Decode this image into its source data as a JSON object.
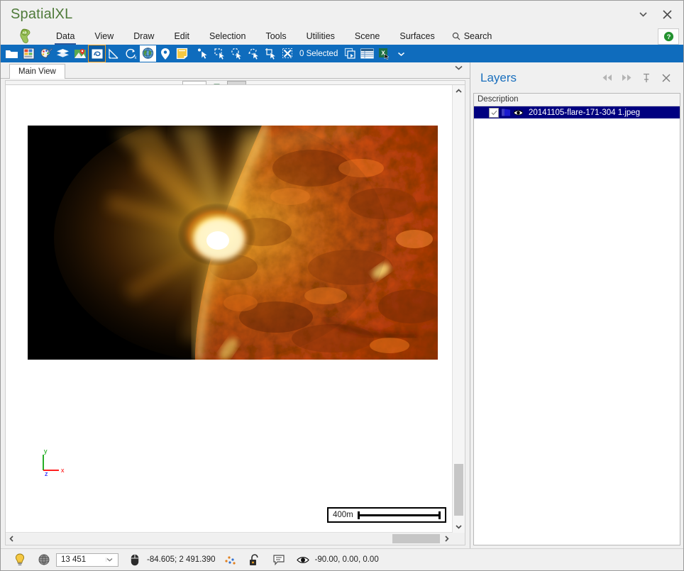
{
  "window": {
    "title": "SpatialXL",
    "title_color": "#4e7a39",
    "dropdown_icon": "chevron-down-icon",
    "close_icon": "close-icon"
  },
  "menubar": {
    "app_icon": "ab-globe-icon",
    "items": [
      {
        "label": "Data",
        "active": true
      },
      {
        "label": "View",
        "active": false
      },
      {
        "label": "Draw",
        "active": false
      },
      {
        "label": "Edit",
        "active": false
      },
      {
        "label": "Selection",
        "active": false
      },
      {
        "label": "Tools",
        "active": false
      },
      {
        "label": "Utilities",
        "active": false
      },
      {
        "label": "Scene",
        "active": false
      },
      {
        "label": "Surfaces",
        "active": false
      }
    ],
    "search_label": "Search",
    "search_icon": "search-icon",
    "help_icon": "help-icon",
    "help_color": "#23912f"
  },
  "ribbon": {
    "background": "#0f6cbd",
    "selection_status": "0 Selected",
    "icons": [
      "open-folder-icon",
      "import-table-icon",
      "palette-pen-icon",
      "layers-stack-icon",
      "map-pin-image-icon",
      "boundary-icon",
      "measure-angle-icon",
      "rotate-axis-icon",
      "globe-icon",
      "location-pin-icon",
      "note-page-icon",
      "select-point-icon",
      "select-rect-icon",
      "select-circle-icon",
      "select-polygon-icon",
      "select-crop-icon",
      "clear-selection-icon",
      "copy-selection-icon",
      "table-grid-icon",
      "excel-export-icon",
      "overflow-chevron-icon"
    ],
    "selected_icon_index": 5,
    "active_icon_index": 8
  },
  "view": {
    "tab_label": "Main View",
    "tab_overflow_icon": "chevron-down-icon",
    "toolbar_icons": [
      "arrow-select-icon",
      "zoom-in-icon",
      "zoom-out-icon",
      "zoom-extents-icon",
      "zoom-window-icon",
      "settings-gear-icon",
      "previous-view-icon",
      "next-view-icon",
      "grid-icon",
      "color-wheel-icon",
      "bookmark-flag-icon",
      "snapshot-icon"
    ]
  },
  "canvas": {
    "axis": {
      "x_label": "x",
      "y_label": "y",
      "z_label": "z",
      "x_color": "#ff0000",
      "y_color": "#00a000",
      "z_color": "#0000ff"
    },
    "scalebar": {
      "label": "400m"
    },
    "image_alt": "20141105-flare-171-304 1.jpeg"
  },
  "layers": {
    "title": "Layers",
    "buttons": [
      "collapse-left-icon",
      "collapse-right-icon",
      "pin-icon",
      "close-icon"
    ],
    "column_header": "Description",
    "rows": [
      {
        "checked": true,
        "layer_icon": "layer-folder-icon",
        "visibility_icon": "eye-icon",
        "name": "20141105-flare-171-304 1.jpeg",
        "selected": true
      }
    ],
    "selection_color": "#000080"
  },
  "statusbar": {
    "hint_icon": "lightbulb-icon",
    "projection_icon": "globe-wire-icon",
    "scale_value": "13 451",
    "scale_dropdown_icon": "chevron-down-icon",
    "cursor_icon": "mouse-icon",
    "coordinates": "-84.605; 2 491.390",
    "points_icon": "scatter-points-icon",
    "lock_icon": "unlock-icon",
    "message_icon": "message-icon",
    "eye_icon": "eye-icon",
    "orientation": "-90.00, 0.00, 0.00"
  }
}
